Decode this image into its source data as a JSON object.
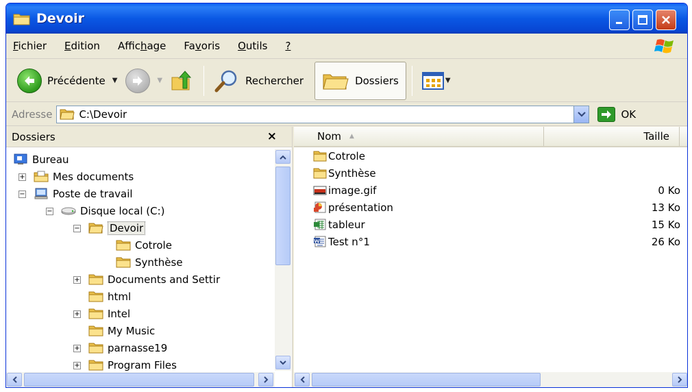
{
  "window": {
    "title": "Devoir"
  },
  "menu": [
    {
      "pre": "",
      "key": "F",
      "post": "ichier"
    },
    {
      "pre": "",
      "key": "E",
      "post": "dition"
    },
    {
      "pre": "Affic",
      "key": "h",
      "post": "age"
    },
    {
      "pre": "Fa",
      "key": "v",
      "post": "oris"
    },
    {
      "pre": "",
      "key": "O",
      "post": "utils"
    },
    {
      "pre": "",
      "key": "?",
      "post": ""
    }
  ],
  "toolbar": {
    "back_label": "Précédente",
    "search_label": "Rechercher",
    "folders_label": "Dossiers"
  },
  "address": {
    "label": "Adresse",
    "value": "C:\\Devoir",
    "go_label": "OK"
  },
  "folders_pane": {
    "title": "Dossiers",
    "close": "×",
    "items": [
      {
        "label": "Bureau",
        "icon": "desktop-icon",
        "expander": ""
      },
      {
        "label": "Mes documents",
        "icon": "my-documents-icon",
        "expander": "+"
      },
      {
        "label": "Poste de travail",
        "icon": "my-computer-icon",
        "expander": "−"
      },
      {
        "label": "Disque local (C:)",
        "icon": "drive-icon",
        "expander": "−"
      },
      {
        "label": "Devoir",
        "icon": "open-folder-icon",
        "expander": "−",
        "selected": true
      },
      {
        "label": "Cotrole",
        "icon": "folder-icon",
        "expander": ""
      },
      {
        "label": "Synthèse",
        "icon": "folder-icon",
        "expander": ""
      },
      {
        "label": "Documents and Settir",
        "icon": "folder-icon",
        "expander": "+"
      },
      {
        "label": "html",
        "icon": "folder-icon",
        "expander": ""
      },
      {
        "label": "Intel",
        "icon": "folder-icon",
        "expander": "+"
      },
      {
        "label": "My Music",
        "icon": "folder-icon",
        "expander": ""
      },
      {
        "label": "parnasse19",
        "icon": "folder-icon",
        "expander": "+"
      },
      {
        "label": "Program Files",
        "icon": "folder-icon",
        "expander": "+"
      }
    ]
  },
  "files": {
    "columns": {
      "name": "Nom",
      "size": "Taille"
    },
    "rows": [
      {
        "name": "Cotrole",
        "size": "",
        "icon": "folder-icon"
      },
      {
        "name": "Synthèse",
        "size": "",
        "icon": "folder-icon"
      },
      {
        "name": "image.gif",
        "size": "0 Ko",
        "icon": "gif-image-icon"
      },
      {
        "name": "présentation",
        "size": "13 Ko",
        "icon": "powerpoint-icon"
      },
      {
        "name": "tableur",
        "size": "15 Ko",
        "icon": "excel-icon"
      },
      {
        "name": "Test n°1",
        "size": "26 Ko",
        "icon": "word-icon"
      }
    ]
  },
  "colors": {
    "titlebar": "#0a58e4",
    "close_button": "#c43b16",
    "folder": "#f5d36b",
    "back_button": "#2e9b1d"
  }
}
